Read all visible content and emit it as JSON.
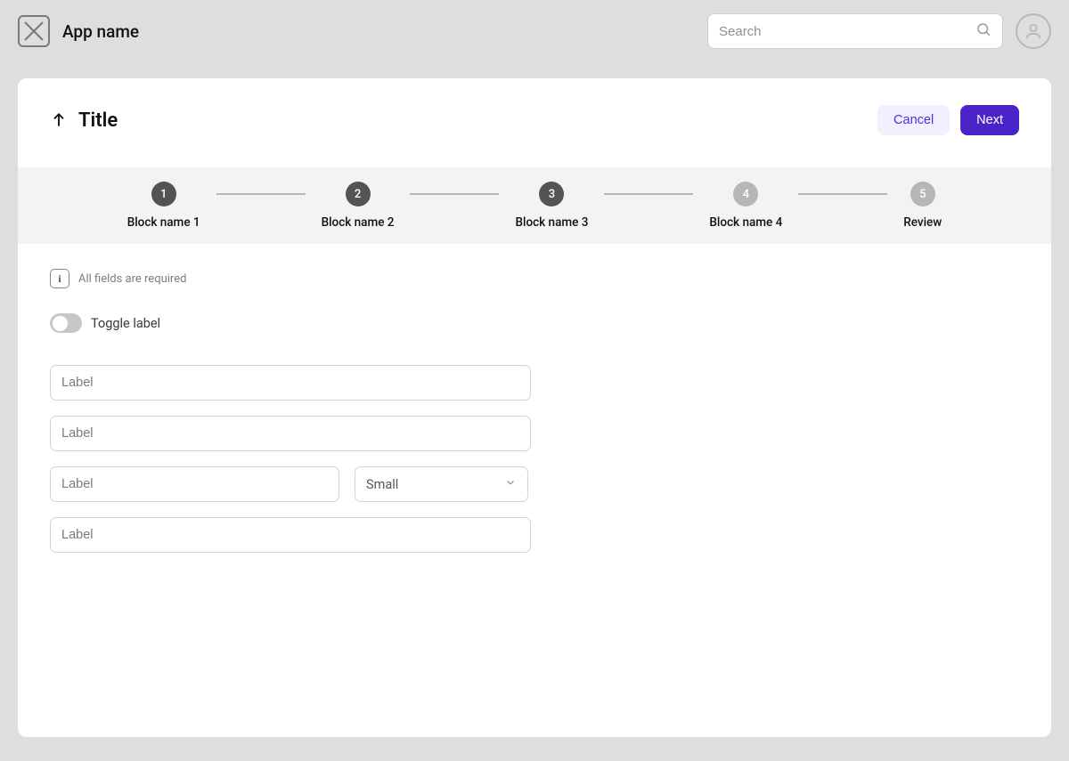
{
  "header": {
    "app_name": "App name",
    "search_placeholder": "Search"
  },
  "page": {
    "title": "Title",
    "cancel_label": "Cancel",
    "next_label": "Next"
  },
  "stepper": {
    "steps": [
      {
        "num": "1",
        "label": "Block name 1",
        "active": true
      },
      {
        "num": "2",
        "label": "Block name 2",
        "active": true
      },
      {
        "num": "3",
        "label": "Block name 3",
        "active": true
      },
      {
        "num": "4",
        "label": "Block name 4",
        "active": false
      },
      {
        "num": "5",
        "label": "Review",
        "active": false
      }
    ]
  },
  "form": {
    "info_text": "All fields are required",
    "info_icon_glyph": "i",
    "toggle_label": "Toggle label",
    "fields": {
      "f1_placeholder": "Label",
      "f2_placeholder": "Label",
      "f3_placeholder": "Label",
      "select_value": "Small",
      "f4_placeholder": "Label"
    }
  },
  "colors": {
    "primary": "#4a24c9",
    "primary_light": "#f2efff"
  }
}
